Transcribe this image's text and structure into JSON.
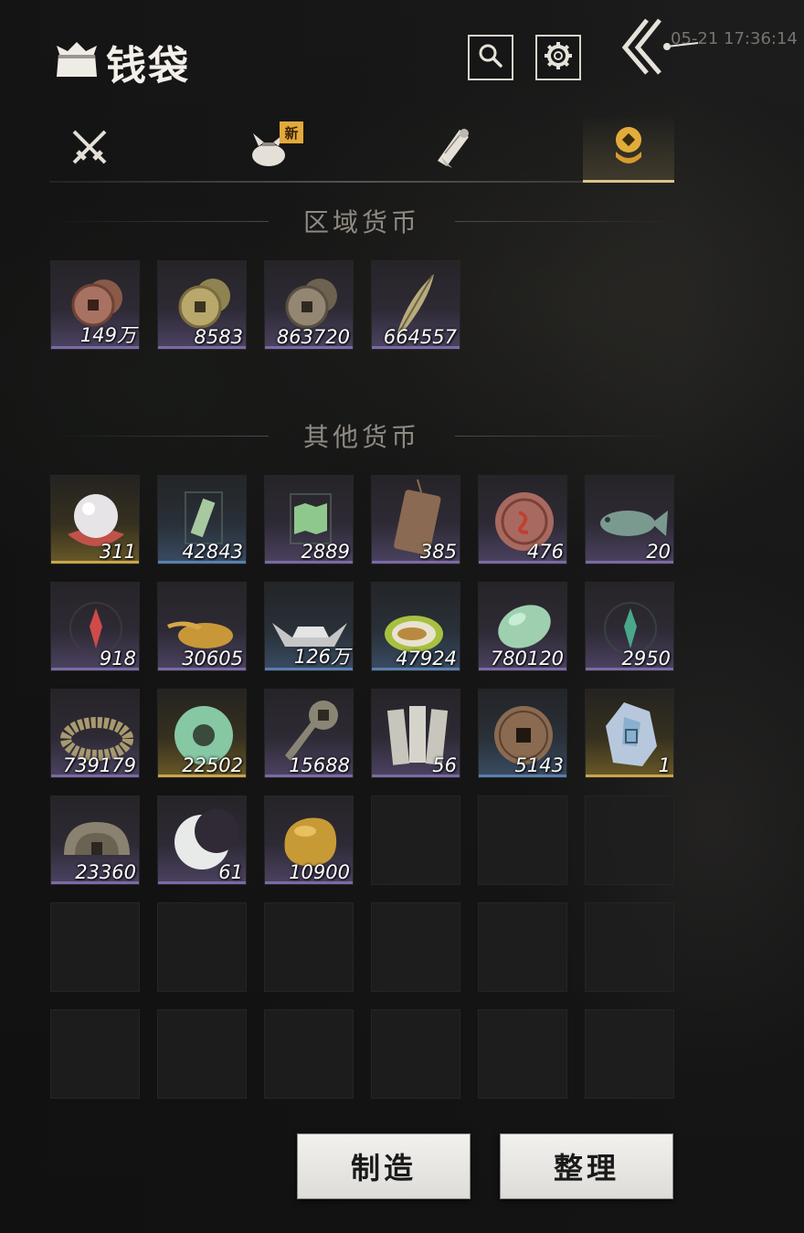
{
  "header": {
    "title": "钱袋",
    "clock": "05-21 17:36:14"
  },
  "tabs": [
    {
      "id": "weapons",
      "icon": "crossed-swords-icon"
    },
    {
      "id": "bag",
      "icon": "bundle-bag-icon",
      "badge": "新"
    },
    {
      "id": "scrolls",
      "icon": "scroll-icon"
    },
    {
      "id": "currency",
      "icon": "coin-stack-icon",
      "active": true
    }
  ],
  "sections": {
    "regional": {
      "title": "区域货币",
      "items": [
        {
          "icon": "copper-coins-icon",
          "count": "149万",
          "rarity": "purple"
        },
        {
          "icon": "brass-coins-icon",
          "count": "8583",
          "rarity": "purple"
        },
        {
          "icon": "bronze-coins-icon",
          "count": "863720",
          "rarity": "purple"
        },
        {
          "icon": "feather-blade-icon",
          "count": "664557",
          "rarity": "purple"
        }
      ]
    },
    "other": {
      "title": "其他货币",
      "items": [
        {
          "icon": "pearl-icon",
          "count": "311",
          "rarity": "gold"
        },
        {
          "icon": "jade-token-icon",
          "count": "42843",
          "rarity": "blue"
        },
        {
          "icon": "map-token-icon",
          "count": "2889",
          "rarity": "purple"
        },
        {
          "icon": "bronze-tablet-icon",
          "count": "385",
          "rarity": "purple"
        },
        {
          "icon": "red-medallion-icon",
          "count": "476",
          "rarity": "purple"
        },
        {
          "icon": "jade-fish-icon",
          "count": "20",
          "rarity": "purple"
        },
        {
          "icon": "red-sigil-icon",
          "count": "918",
          "rarity": "purple"
        },
        {
          "icon": "grain-pile-icon",
          "count": "30605",
          "rarity": "purple"
        },
        {
          "icon": "silver-ingot-icon",
          "count": "126万",
          "rarity": "blue"
        },
        {
          "icon": "melon-icon",
          "count": "47924",
          "rarity": "blue"
        },
        {
          "icon": "jade-stone-icon",
          "count": "780120",
          "rarity": "purple"
        },
        {
          "icon": "green-sigil-icon",
          "count": "2950",
          "rarity": "purple"
        },
        {
          "icon": "coin-string-icon",
          "count": "739179",
          "rarity": "purple"
        },
        {
          "icon": "jade-disc-icon",
          "count": "22502",
          "rarity": "gold"
        },
        {
          "icon": "key-coin-icon",
          "count": "15688",
          "rarity": "purple"
        },
        {
          "icon": "paper-slips-icon",
          "count": "56",
          "rarity": "purple"
        },
        {
          "icon": "square-hole-coin-icon",
          "count": "5143",
          "rarity": "blue"
        },
        {
          "icon": "crystal-ore-icon",
          "count": "1",
          "rarity": "gold"
        },
        {
          "icon": "half-coin-icon",
          "count": "23360",
          "rarity": "purple"
        },
        {
          "icon": "crescent-jade-icon",
          "count": "61",
          "rarity": "purple"
        },
        {
          "icon": "gold-nugget-icon",
          "count": "10900",
          "rarity": "purple"
        }
      ]
    }
  },
  "buttons": {
    "make": "制造",
    "sort": "整理"
  }
}
